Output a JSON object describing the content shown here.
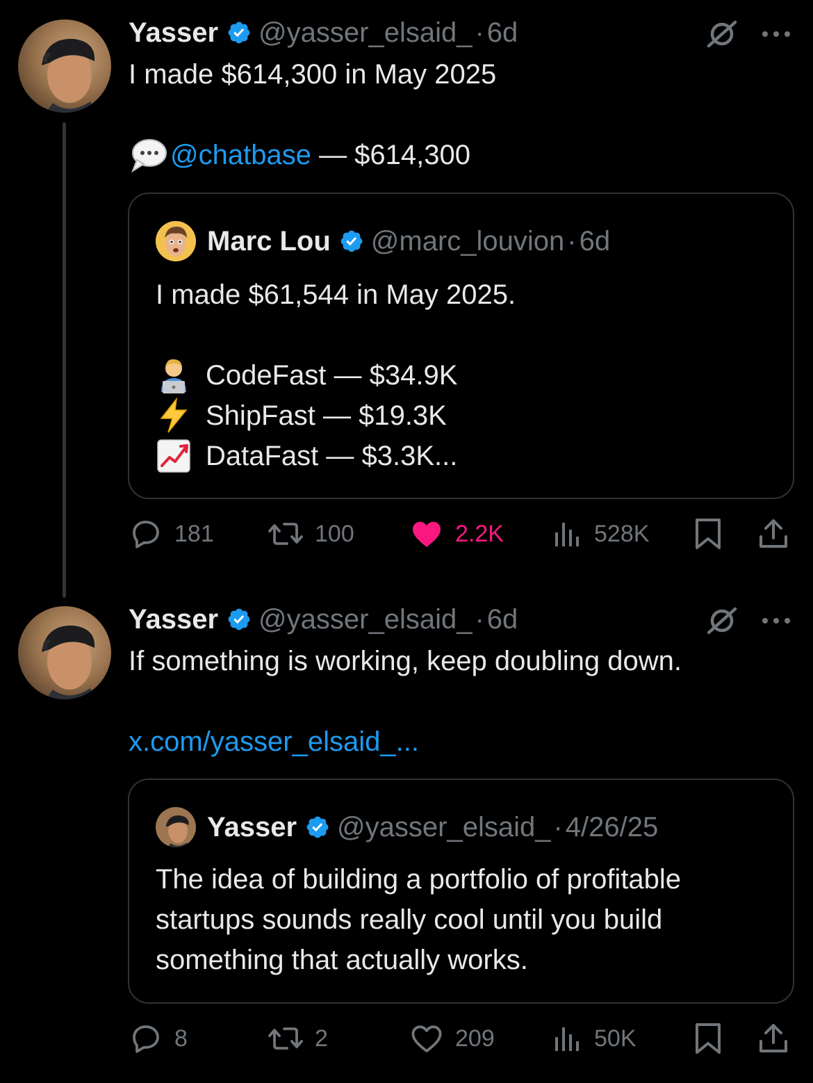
{
  "colors": {
    "background": "#000000",
    "text_primary": "#e7e9ea",
    "text_secondary": "#71767b",
    "link": "#1d9bf0",
    "verified": "#1d9bf0",
    "like_active": "#f91880",
    "border": "#2f3336"
  },
  "tweets": [
    {
      "author": {
        "name": "Yasser",
        "handle": "@yasser_elsaid_",
        "verified": true
      },
      "time": "6d",
      "text_line1": "I made $614,300 in May 2025",
      "text_line2_mention": "@chatbase",
      "text_line2_rest": " — $614,300",
      "text_line2_emoji": "speech-bubble-emoji",
      "quote": {
        "author": {
          "name": "Marc Lou",
          "handle": "@marc_louvion",
          "verified": true
        },
        "time": "6d",
        "text_line1": "I made $61,544 in May 2025.",
        "items": [
          {
            "emoji": "technologist-emoji",
            "text": "CodeFast — $34.9K"
          },
          {
            "emoji": "lightning-emoji",
            "text": "ShipFast — $19.3K"
          },
          {
            "emoji": "chart-increasing-emoji",
            "text": "DataFast — $3.3K..."
          }
        ]
      },
      "actions": {
        "replies": "181",
        "reposts": "100",
        "likes": "2.2K",
        "views": "528K",
        "liked": true
      }
    },
    {
      "author": {
        "name": "Yasser",
        "handle": "@yasser_elsaid_",
        "verified": true
      },
      "time": "6d",
      "text_line1": "If something is working, keep doubling down.",
      "link": "x.com/yasser_elsaid_...",
      "quote": {
        "author": {
          "name": "Yasser",
          "handle": "@yasser_elsaid_",
          "verified": true
        },
        "time": "4/26/25",
        "lines": [
          "The idea of building a portfolio of profitable",
          "startups sounds really cool until you build",
          "something that actually works."
        ]
      },
      "actions": {
        "replies": "8",
        "reposts": "2",
        "likes": "209",
        "views": "50K",
        "liked": false
      }
    }
  ]
}
